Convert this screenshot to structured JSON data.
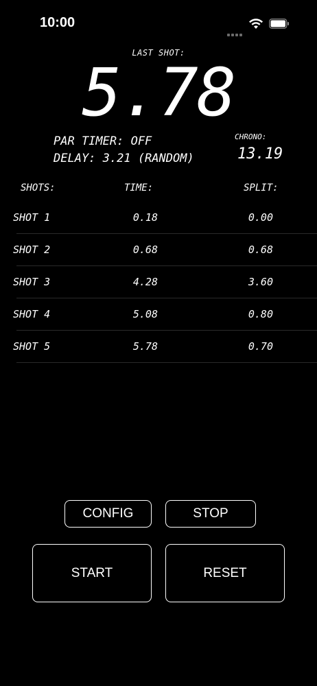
{
  "status_bar": {
    "time": "10:00"
  },
  "display": {
    "last_shot_label": "LAST SHOT:",
    "last_shot_value": "5.78",
    "par_timer": "PAR TIMER: OFF",
    "delay": "DELAY: 3.21 (RANDOM)",
    "chrono_label": "CHRONO:",
    "chrono_value": "13.19"
  },
  "table": {
    "headers": {
      "shots": "SHOTS:",
      "time": "TIME:",
      "split": "SPLIT:"
    },
    "rows": [
      {
        "name": "SHOT 1",
        "time": "0.18",
        "split": "0.00"
      },
      {
        "name": "SHOT 2",
        "time": "0.68",
        "split": "0.68"
      },
      {
        "name": "SHOT 3",
        "time": "4.28",
        "split": "3.60"
      },
      {
        "name": "SHOT 4",
        "time": "5.08",
        "split": "0.80"
      },
      {
        "name": "SHOT 5",
        "time": "5.78",
        "split": "0.70"
      }
    ]
  },
  "buttons": {
    "config": "CONFIG",
    "stop": "STOP",
    "start": "START",
    "reset": "RESET"
  }
}
